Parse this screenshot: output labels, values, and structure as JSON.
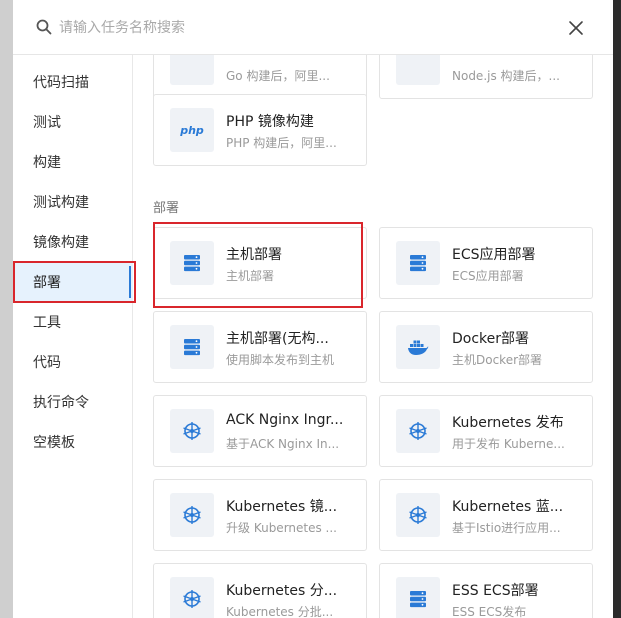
{
  "search": {
    "placeholder": "请输入任务名称搜索"
  },
  "sidebar": {
    "items": [
      {
        "label": "代码扫描"
      },
      {
        "label": "测试"
      },
      {
        "label": "构建"
      },
      {
        "label": "测试构建"
      },
      {
        "label": "镜像构建"
      },
      {
        "label": "部署",
        "active": true
      },
      {
        "label": "工具"
      },
      {
        "label": "代码"
      },
      {
        "label": "执行命令"
      },
      {
        "label": "空模板"
      }
    ]
  },
  "main": {
    "top_cards": [
      {
        "title": "",
        "desc": "Go 构建后，阿里..."
      },
      {
        "title": "",
        "desc": "Node.js 构建后，..."
      },
      {
        "title": "PHP 镜像构建",
        "desc": "PHP 构建后，阿里...",
        "icon": "php-icon",
        "icon_text": "php"
      }
    ],
    "section_title": "部署",
    "deploy_cards": [
      {
        "title": "主机部署",
        "desc": "主机部署",
        "icon": "server-icon"
      },
      {
        "title": "ECS应用部署",
        "desc": "ECS应用部署",
        "icon": "server-icon"
      },
      {
        "title": "主机部署(无构...",
        "desc": "使用脚本发布到主机",
        "icon": "server-icon"
      },
      {
        "title": "Docker部署",
        "desc": "主机Docker部署",
        "icon": "docker-icon"
      },
      {
        "title": "ACK Nginx Ingr...",
        "desc": "基于ACK Nginx In...",
        "icon": "kubernetes-icon"
      },
      {
        "title": "Kubernetes 发布",
        "desc": "用于发布 Kuberne...",
        "icon": "kubernetes-icon"
      },
      {
        "title": "Kubernetes 镜...",
        "desc": "升级 Kubernetes ...",
        "icon": "kubernetes-icon"
      },
      {
        "title": "Kubernetes 蓝...",
        "desc": "基于Istio进行应用...",
        "icon": "kubernetes-icon"
      },
      {
        "title": "Kubernetes 分...",
        "desc": "Kubernetes 分批...",
        "icon": "kubernetes-icon"
      },
      {
        "title": "ESS ECS部署",
        "desc": "ESS ECS发布",
        "icon": "server-icon"
      }
    ]
  },
  "colors": {
    "accent": "#2a7ad6",
    "highlight": "#d9262c",
    "active_bg": "#e6f2fd",
    "icon_bg": "#eff2f6"
  }
}
